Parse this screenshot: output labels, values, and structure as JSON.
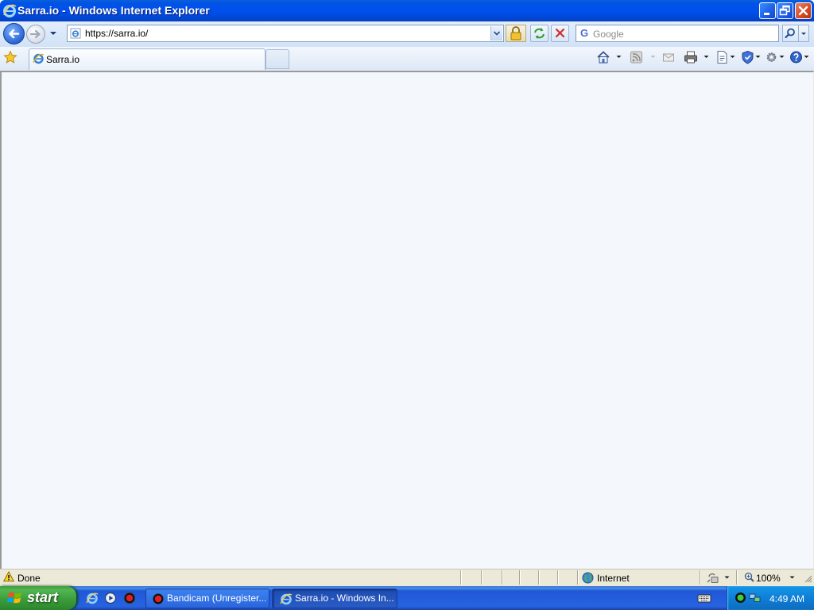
{
  "window": {
    "title": "Sarra.io - Windows Internet Explorer",
    "title_icon": "ie-logo-icon"
  },
  "navigation": {
    "address": "https://sarra.io/",
    "search_placeholder": "Google",
    "back_icon": "back-arrow-icon",
    "forward_icon": "forward-arrow-icon",
    "refresh_icon": "refresh-icon",
    "stop_icon": "stop-icon",
    "security_icon": "padlock-icon"
  },
  "tabs": [
    {
      "label": "Sarra.io",
      "active": true
    }
  ],
  "command_bar": {
    "items": [
      "home-icon",
      "feeds-icon",
      "mail-icon",
      "print-icon",
      "page-icon",
      "safety-icon",
      "tools-icon",
      "help-icon"
    ]
  },
  "status_bar": {
    "status": "Done",
    "zone": "Internet",
    "zoom": "100%"
  },
  "taskbar": {
    "start_label": "start",
    "quick_launch": [
      "ie-icon",
      "media-player-icon",
      "bandicam-icon"
    ],
    "tasks": [
      {
        "label": "Bandicam (Unregister...",
        "active": false
      },
      {
        "label": "Sarra.io - Windows In...",
        "active": true
      }
    ],
    "clock": "4:49 AM"
  },
  "colors": {
    "title_bar": "#0050ee",
    "content_background": "#f4f8fd",
    "taskbar": "#2663e0",
    "start_button": "#3a9a3a",
    "tray": "#0f7fd6"
  }
}
